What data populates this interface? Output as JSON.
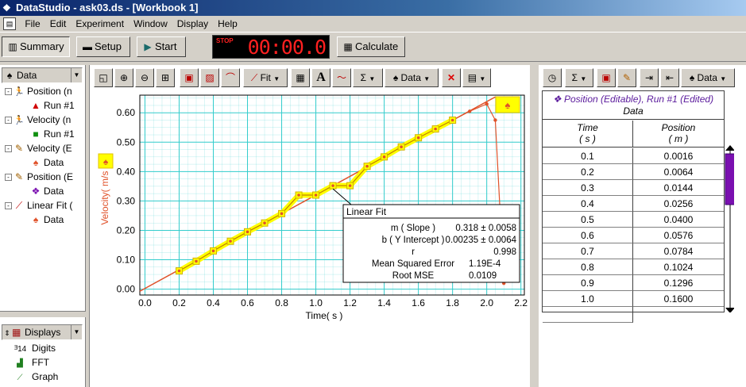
{
  "window": {
    "title": "DataStudio - ask03.ds - [Workbook 1]"
  },
  "menu": [
    "File",
    "Edit",
    "Experiment",
    "Window",
    "Display",
    "Help"
  ],
  "toolbar": {
    "summary_label": "Summary",
    "setup_label": "Setup",
    "start_label": "Start",
    "timer_stop_label": "STOP",
    "timer_value": "00:00.0",
    "calculate_label": "Calculate"
  },
  "left_pane": {
    "data_combo": "Data",
    "tree": [
      {
        "label": "Position (n",
        "icon": "runner-icon",
        "level": 0,
        "expanded": "-"
      },
      {
        "label": "Run #1",
        "icon": "red-triangle-icon",
        "level": 1
      },
      {
        "label": "Velocity (n",
        "icon": "runner-icon",
        "level": 0,
        "expanded": "-"
      },
      {
        "label": "Run #1",
        "icon": "green-square-icon",
        "level": 1
      },
      {
        "label": "Velocity (E",
        "icon": "pencil-icon",
        "level": 0,
        "expanded": "-"
      },
      {
        "label": "Data",
        "icon": "orange-spade-icon",
        "level": 1
      },
      {
        "label": "Position (E",
        "icon": "pencil-icon",
        "level": 0,
        "expanded": "-"
      },
      {
        "label": "Data",
        "icon": "purple-diamond-icon",
        "level": 1
      },
      {
        "label": "Linear Fit (",
        "icon": "line-fit-icon",
        "level": 0,
        "expanded": "-"
      },
      {
        "label": "Data",
        "icon": "orange-spade-icon",
        "level": 1
      }
    ],
    "displays_combo": "Displays",
    "displays": [
      {
        "label": "Digits",
        "icon": "digits-icon"
      },
      {
        "label": "FFT",
        "icon": "fft-icon"
      },
      {
        "label": "Graph",
        "icon": "graph-icon"
      }
    ]
  },
  "graph_toolbar": {
    "fit_label": "Fit",
    "data_label": "Data"
  },
  "chart_data": {
    "type": "line",
    "xlabel": "Time( s )",
    "ylabel": "Velocity( m/s )",
    "xlim": [
      -0.03,
      2.22
    ],
    "ylim": [
      -0.02,
      0.66
    ],
    "xticks": [
      "0.0",
      "0.2",
      "0.4",
      "0.6",
      "0.8",
      "1.0",
      "1.2",
      "1.4",
      "1.6",
      "1.8",
      "2.0",
      "2.2"
    ],
    "yticks": [
      "0.00",
      "0.10",
      "0.20",
      "0.30",
      "0.40",
      "0.50",
      "0.60"
    ],
    "grid": true,
    "series": [
      {
        "style": "yellow-highlighted markers and line",
        "x": [
          0.2,
          0.3,
          0.4,
          0.5,
          0.6,
          0.7,
          0.8,
          0.9,
          1.0,
          1.1,
          1.2,
          1.3,
          1.4,
          1.5,
          1.6,
          1.7,
          1.8
        ],
        "y": [
          0.062,
          0.095,
          0.13,
          0.163,
          0.195,
          0.225,
          0.257,
          0.32,
          0.32,
          0.352,
          0.352,
          0.418,
          0.45,
          0.484,
          0.515,
          0.545,
          0.575
        ]
      },
      {
        "style": "orange velocity line with markers",
        "x": [
          1.9,
          2.0,
          2.05,
          2.1
        ],
        "y": [
          0.605,
          0.63,
          0.575,
          0.02
        ]
      },
      {
        "style": "linear fit line",
        "x": [
          -0.03,
          2.05
        ],
        "y": [
          -0.0072,
          0.654
        ]
      }
    ],
    "colors": {
      "data": "#ffff00",
      "line": "#e0522a",
      "fit": "#e0522a",
      "grid": "#33cccc"
    },
    "fit_box": {
      "title": "Linear Fit",
      "rows": [
        {
          "label": "m ( Slope )",
          "value": "0.318 ± 0.0058"
        },
        {
          "label": "b ( Y Intercept )",
          "value": "0.00235 ± 0.0064"
        },
        {
          "label": "r",
          "value": "0.998"
        },
        {
          "label": "Mean Squared Error",
          "value": "1.19E-4"
        },
        {
          "label": "Root MSE",
          "value": "0.0109"
        }
      ]
    }
  },
  "table": {
    "toolbar_data_label": "Data",
    "title": "Position (Editable), Run #1 (Edited)",
    "subtitle": "Data",
    "columns": [
      {
        "name": "Time",
        "unit": "( s )"
      },
      {
        "name": "Position",
        "unit": "( m )"
      }
    ],
    "rows": [
      [
        "0.1",
        "0.0016"
      ],
      [
        "0.2",
        "0.0064"
      ],
      [
        "0.3",
        "0.0144"
      ],
      [
        "0.4",
        "0.0256"
      ],
      [
        "0.5",
        "0.0400"
      ],
      [
        "0.6",
        "0.0576"
      ],
      [
        "0.7",
        "0.0784"
      ],
      [
        "0.8",
        "0.1024"
      ],
      [
        "0.9",
        "0.1296"
      ],
      [
        "1.0",
        "0.1600"
      ]
    ]
  }
}
